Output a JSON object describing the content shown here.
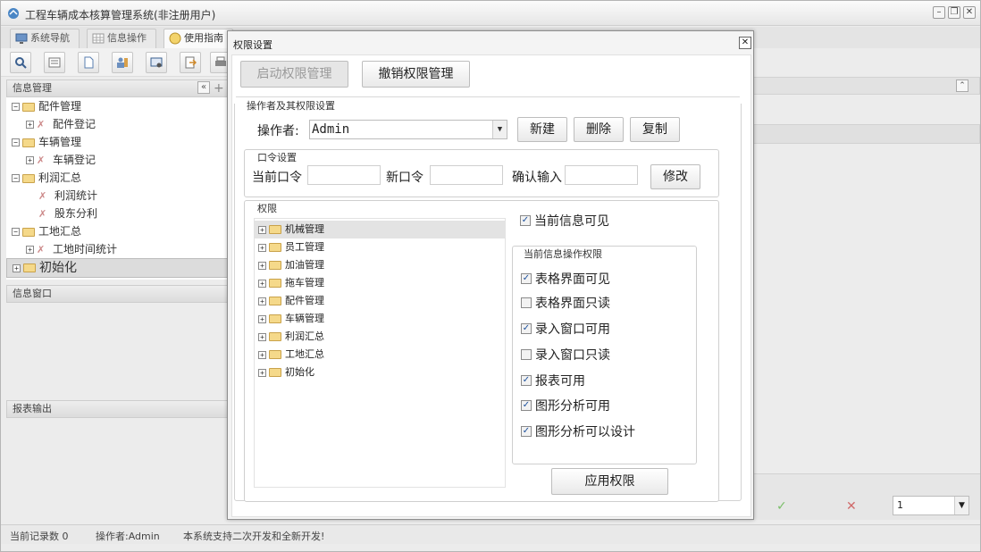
{
  "app": {
    "title": "工程车辆成本核算管理系统(非注册用户)"
  },
  "tabs": [
    {
      "label": "系统导航"
    },
    {
      "label": "信息操作"
    },
    {
      "label": "使用指南"
    }
  ],
  "left": {
    "info_panel_title": "信息管理",
    "tree": [
      {
        "label": "配件管理"
      },
      {
        "label": "配件登记"
      },
      {
        "label": "车辆管理"
      },
      {
        "label": "车辆登记"
      },
      {
        "label": "利润汇总"
      },
      {
        "label": "利润统计"
      },
      {
        "label": "股东分利"
      },
      {
        "label": "工地汇总"
      },
      {
        "label": "工地时间统计"
      },
      {
        "label": "初始化"
      }
    ],
    "info_window_title": "信息窗口",
    "report_title": "报表输出"
  },
  "right": {
    "page_value": "1"
  },
  "status": {
    "records": "当前记录数 0",
    "operator": "操作者:Admin",
    "note": "本系统支持二次开发和全新开发!"
  },
  "dialog": {
    "title": "权限设置",
    "enable_btn": "启动权限管理",
    "revoke_btn": "撤销权限管理",
    "operator_group": "操作者及其权限设置",
    "operator_label": "操作者:",
    "operator_value": "Admin",
    "new_btn": "新建",
    "delete_btn": "删除",
    "copy_btn": "复制",
    "password_group": "口令设置",
    "current_pw_label": "当前口令",
    "new_pw_label": "新口令",
    "confirm_label": "确认输入",
    "modify_btn": "修改",
    "perm_group": "权限",
    "perm_tree": [
      {
        "label": "机械管理"
      },
      {
        "label": "员工管理"
      },
      {
        "label": "加油管理"
      },
      {
        "label": "拖车管理"
      },
      {
        "label": "配件管理"
      },
      {
        "label": "车辆管理"
      },
      {
        "label": "利润汇总"
      },
      {
        "label": "工地汇总"
      },
      {
        "label": "初始化"
      }
    ],
    "visible_checkbox": {
      "label": "当前信息可见",
      "checked": true
    },
    "ops_group": "当前信息操作权限",
    "ops": [
      {
        "label": "表格界面可见",
        "checked": true
      },
      {
        "label": "表格界面只读",
        "checked": false
      },
      {
        "label": "录入窗口可用",
        "checked": true
      },
      {
        "label": "录入窗口只读",
        "checked": false
      },
      {
        "label": "报表可用",
        "checked": true
      },
      {
        "label": "图形分析可用",
        "checked": true
      },
      {
        "label": "图形分析可以设计",
        "checked": true
      }
    ],
    "apply_btn": "应用权限"
  }
}
